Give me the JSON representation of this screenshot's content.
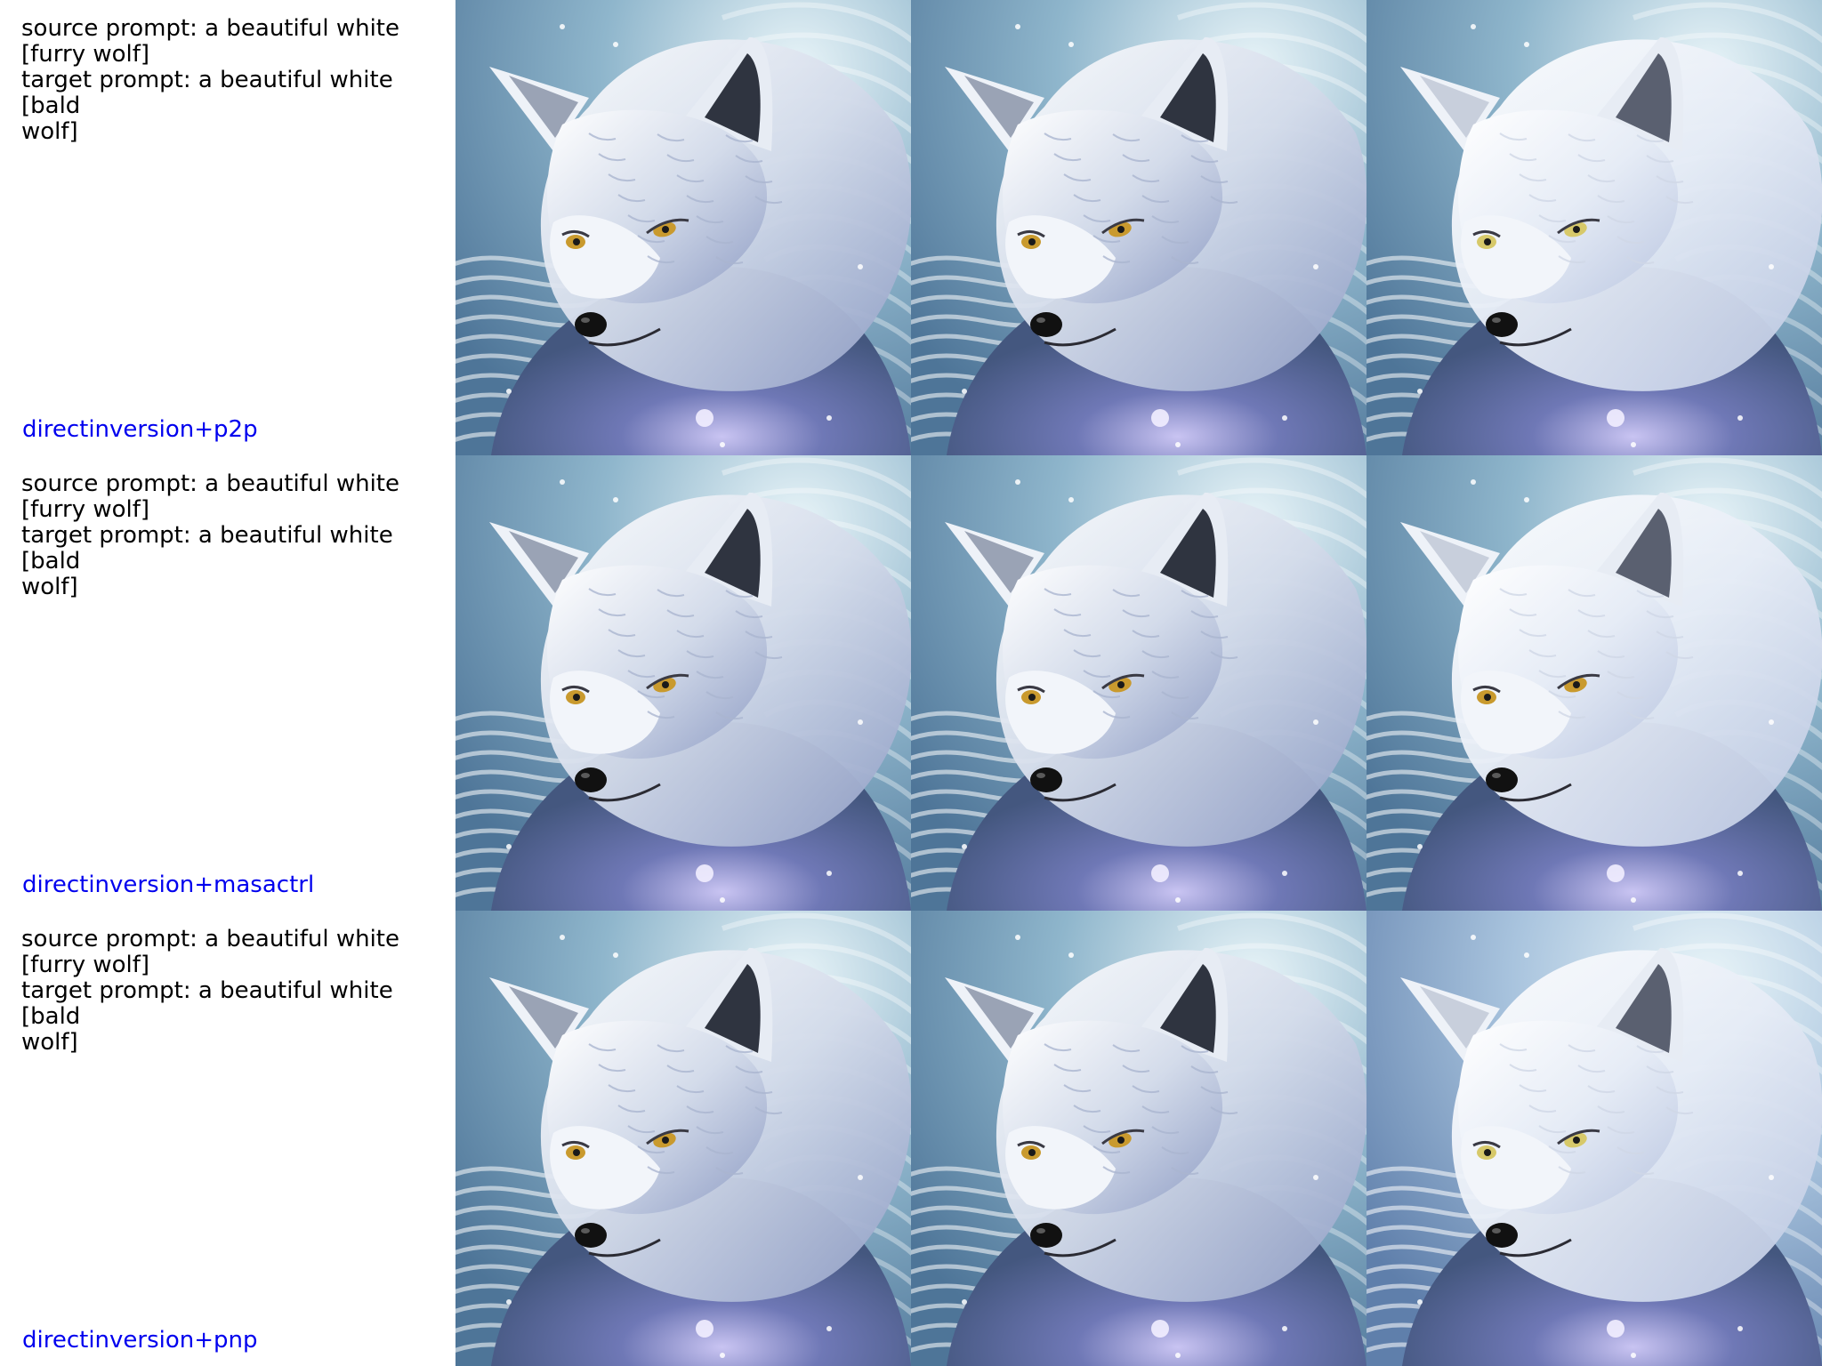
{
  "rows": [
    {
      "prompt": "source prompt: a beautiful white\n[furry wolf]\ntarget prompt: a beautiful white [bald\nwolf]",
      "method": "directinversion+p2p",
      "images": [
        "furry wolf portrait (source)",
        "furry wolf portrait (reconstruction)",
        "edited wolf portrait"
      ]
    },
    {
      "prompt": "source prompt: a beautiful white\n[furry wolf]\ntarget prompt: a beautiful white [bald\nwolf]",
      "method": "directinversion+masactrl",
      "images": [
        "furry wolf portrait (source)",
        "furry wolf portrait (reconstruction)",
        "edited wolf portrait"
      ]
    },
    {
      "prompt": "source prompt: a beautiful white\n[furry wolf]\ntarget prompt: a beautiful white [bald\nwolf]",
      "method": "directinversion+pnp",
      "images": [
        "furry wolf portrait (source)",
        "furry wolf portrait (reconstruction)",
        "edited wolf portrait"
      ]
    }
  ],
  "colors": {
    "method_label": "#0000ee",
    "prompt_text": "#000000",
    "bg_teal": "#6f9fb8",
    "fur_white": "#e9eef6",
    "fur_blue": "#7f8fbd",
    "eye_amber": "#c99a2e"
  }
}
